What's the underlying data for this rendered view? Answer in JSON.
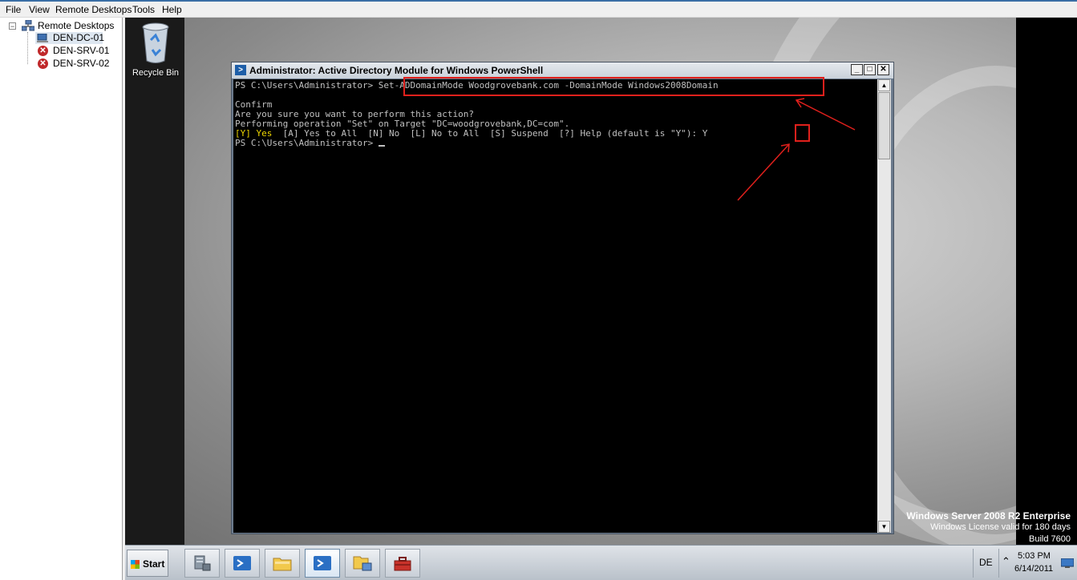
{
  "menubar": {
    "items": [
      "File",
      "View",
      "Remote Desktops",
      "Tools",
      "Help"
    ]
  },
  "tree": {
    "root_label": "Remote Desktops",
    "root_expander": "−",
    "nodes": [
      {
        "label": "DEN-DC-01",
        "icon": "computer-icon",
        "selected": true
      },
      {
        "label": "DEN-SRV-01",
        "icon": "error-icon",
        "selected": false
      },
      {
        "label": "DEN-SRV-02",
        "icon": "error-icon",
        "selected": false
      }
    ]
  },
  "desktop": {
    "recycle_bin_label": "Recycle Bin",
    "watermark": {
      "line1": "Windows Server 2008 R2 Enterprise",
      "line2": "Windows License valid for 180 days",
      "line3": "Build 7600"
    }
  },
  "powershell": {
    "title": "Administrator: Active Directory Module for Windows PowerShell",
    "minimize": "_",
    "maximize": "□",
    "close": "✕",
    "lines": {
      "l1": "PS C:\\Users\\Administrator> Set-ADDomainMode Woodgrovebank.com -DomainMode Windows2008Domain",
      "l2": "",
      "l3": "Confirm",
      "l4": "Are you sure you want to perform this action?",
      "l5": "Performing operation \"Set\" on Target \"DC=woodgrovebank,DC=com\".",
      "l6_yes": "[Y] Yes",
      "l6_rest": "  [A] Yes to All  [N] No  [L] No to All  [S] Suspend  [?] Help (default is \"Y\"): Y",
      "l7": "PS C:\\Users\\Administrator> "
    },
    "annotation_color": "#e0201c"
  },
  "taskbar": {
    "start_label": "Start",
    "items": [
      {
        "name": "server-manager",
        "icon": "server-manager-icon",
        "active": false
      },
      {
        "name": "powershell-pinned",
        "icon": "powershell-icon",
        "active": false
      },
      {
        "name": "explorer",
        "icon": "folder-icon",
        "active": false
      },
      {
        "name": "powershell-active",
        "icon": "powershell-icon",
        "active": true
      },
      {
        "name": "ad-users",
        "icon": "ad-folder-icon",
        "active": false
      },
      {
        "name": "toolbox",
        "icon": "toolbox-icon",
        "active": false
      }
    ],
    "language": "DE",
    "time": "5:03 PM",
    "date": "6/14/2011"
  }
}
